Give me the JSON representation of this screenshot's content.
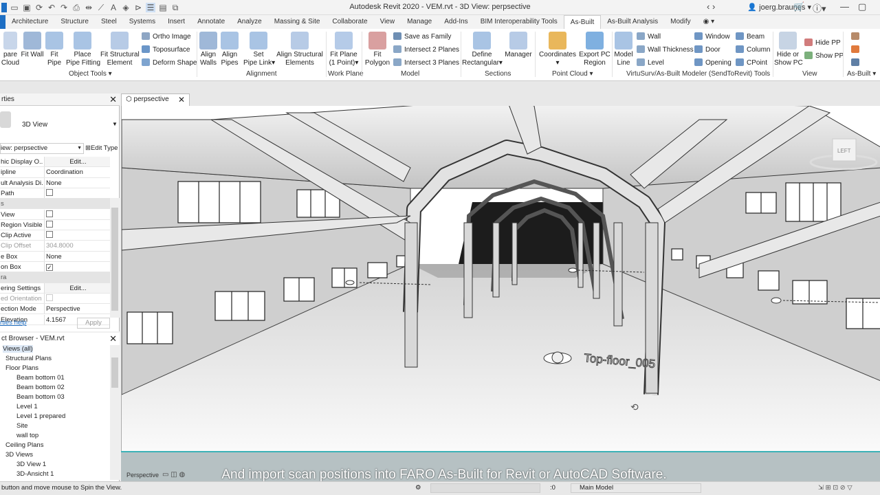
{
  "app": {
    "title": "Autodesk Revit 2020 - VEM.rvt - 3D View: perpsective",
    "user": "joerg.braunes"
  },
  "tabs": [
    "Architecture",
    "Structure",
    "Steel",
    "Systems",
    "Insert",
    "Annotate",
    "Analyze",
    "Massing & Site",
    "Collaborate",
    "View",
    "Manage",
    "Add-Ins",
    "BIM Interoperability Tools",
    "As-Built",
    "As-Built Analysis",
    "Modify"
  ],
  "active_tab": "As-Built",
  "ribbon": {
    "prepare_cloud": "pare\nCloud",
    "fit_wall": "Fit Wall",
    "fit_pipe": "Fit\nPipe",
    "place_pipe_fitting": "Place\nPipe Fitting",
    "fit_structural_element": "Fit Structural\nElement",
    "ortho_image": "Ortho Image",
    "toposurface": "Toposurface",
    "deform_shape": "Deform Shape",
    "group_object_tools": "Object Tools",
    "align_walls": "Align\nWalls",
    "align_pipes": "Align\nPipes",
    "set_pipe_link": "Set\nPipe Link",
    "align_structural_elements": "Align Structural\nElements",
    "group_alignment": "Alignment",
    "fit_plane": "Fit Plane\n(1 Point)",
    "group_work_plane": "Work Plane",
    "fit_polygon": "Fit\nPolygon",
    "save_as_family": "Save as Family",
    "intersect2": "Intersect 2 Planes",
    "intersect3": "Intersect 3 Planes",
    "group_model": "Model",
    "define_rectangular": "Define\nRectangular",
    "manager": "Manager",
    "group_sections": "Sections",
    "coordinates": "Coordinates",
    "export_pc_region": "Export PC\nRegion",
    "group_point_cloud": "Point Cloud",
    "model_line": "Model\nLine",
    "wall": "Wall",
    "wall_thickness": "Wall Thickness",
    "level": "Level",
    "window": "Window",
    "door": "Door",
    "opening": "Opening",
    "beam": "Beam",
    "column": "Column",
    "cpoint": "CPoint",
    "group_virtusurv": "VirtuSurv/As-Built Modeler (SendToRevit) Tools",
    "hide_or_show_pc": "Hide or\nShow PC",
    "hide_pp": "Hide PP",
    "show_pp": "Show PP",
    "group_view": "View",
    "group_asbuilt": "As-Built"
  },
  "properties": {
    "header": "rties",
    "type": "3D View",
    "view_selector": "iew: perpsective",
    "edit_type": "Edit Type",
    "rows": [
      {
        "k": "hic Display O...",
        "v": "Edit...",
        "kind": "btn"
      },
      {
        "k": "ipline",
        "v": "Coordination"
      },
      {
        "k": "ult Analysis Di...",
        "v": "None"
      },
      {
        "k": "Path",
        "v": "",
        "kind": "cb"
      },
      {
        "k": "s",
        "v": "",
        "kind": "sec"
      },
      {
        "k": " View",
        "v": "",
        "kind": "cb"
      },
      {
        "k": " Region Visible",
        "v": "",
        "kind": "cb"
      },
      {
        "k": "Clip Active",
        "v": "",
        "kind": "cb"
      },
      {
        "k": "Clip Offset",
        "v": "304.8000",
        "kind": "dim"
      },
      {
        "k": "e Box",
        "v": "None"
      },
      {
        "k": "on Box",
        "v": "",
        "kind": "cbx"
      },
      {
        "k": "ra",
        "v": "",
        "kind": "sec"
      },
      {
        "k": "ering Settings",
        "v": "Edit...",
        "kind": "btn"
      },
      {
        "k": "ed Orientation",
        "v": "",
        "kind": "dimcb"
      },
      {
        "k": "ection Mode",
        "v": "Perspective"
      },
      {
        "k": "Elevation",
        "v": "4.1567"
      }
    ],
    "help": "rties help",
    "apply": "Apply"
  },
  "browser": {
    "title": "ct Browser - VEM.rvt",
    "items": [
      {
        "t": "Views (all)",
        "l": 0
      },
      {
        "t": "Structural Plans",
        "l": 1
      },
      {
        "t": "Floor Plans",
        "l": 1
      },
      {
        "t": "Beam bottom 01",
        "l": 2
      },
      {
        "t": "Beam bottom 02",
        "l": 2
      },
      {
        "t": "Beam bottom 03",
        "l": 2
      },
      {
        "t": "Level 1",
        "l": 2
      },
      {
        "t": "Level 1 prepared",
        "l": 2
      },
      {
        "t": "Site",
        "l": 2
      },
      {
        "t": "wall top",
        "l": 2
      },
      {
        "t": "Ceiling Plans",
        "l": 1
      },
      {
        "t": "3D Views",
        "l": 1
      },
      {
        "t": "3D View 1",
        "l": 2
      },
      {
        "t": "3D-Ansicht 1",
        "l": 2
      }
    ]
  },
  "view_tab": "perpsective",
  "viewcube": "LEFT",
  "scan_label": "Top-floor_005",
  "view_control": "Perspective",
  "caption": "And import scan positions into FARO As-Built for Revit or AutoCAD Software.",
  "status_text": "button and move mouse to Spin the View.",
  "model_selector": "Main Model",
  "colors": {
    "accent": "#1e6fc4",
    "caption_bar": "#3bb2b7"
  }
}
